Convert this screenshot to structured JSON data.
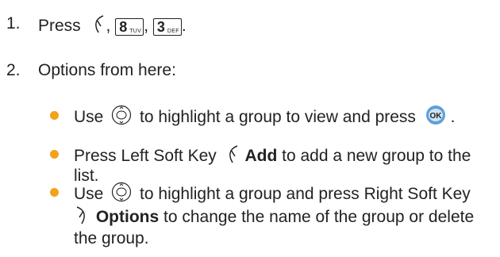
{
  "step1": {
    "num": "1.",
    "text": "Press",
    "key8": {
      "digit": "8",
      "letters": "TUV"
    },
    "key3": {
      "digit": "3",
      "letters": "DEF"
    },
    "icon": "left-soft-key-icon"
  },
  "step2": {
    "num": "2.",
    "text": "Options from here:"
  },
  "bullets": [
    {
      "use": "Use",
      "text_after_nav": "to highlight a group to view and press",
      "end": ".",
      "icons": [
        "navigation-key-icon",
        "ok-key-icon"
      ]
    },
    {
      "pre": "Press Left Soft Key",
      "bold": "Add",
      "post": "to add a new group to the",
      "cont": "list.",
      "icons": [
        "left-soft-key-icon"
      ]
    },
    {
      "use": "Use",
      "text_after_nav": "to highlight a group and press Right Soft Key",
      "bold": "Options",
      "post": "to change the name of the group or delete",
      "cont": "the group.",
      "icons": [
        "navigation-key-icon",
        "right-soft-key-icon"
      ]
    }
  ],
  "colors": {
    "bullet": "#f2a31b",
    "ok_key": "#5ea0d8"
  }
}
